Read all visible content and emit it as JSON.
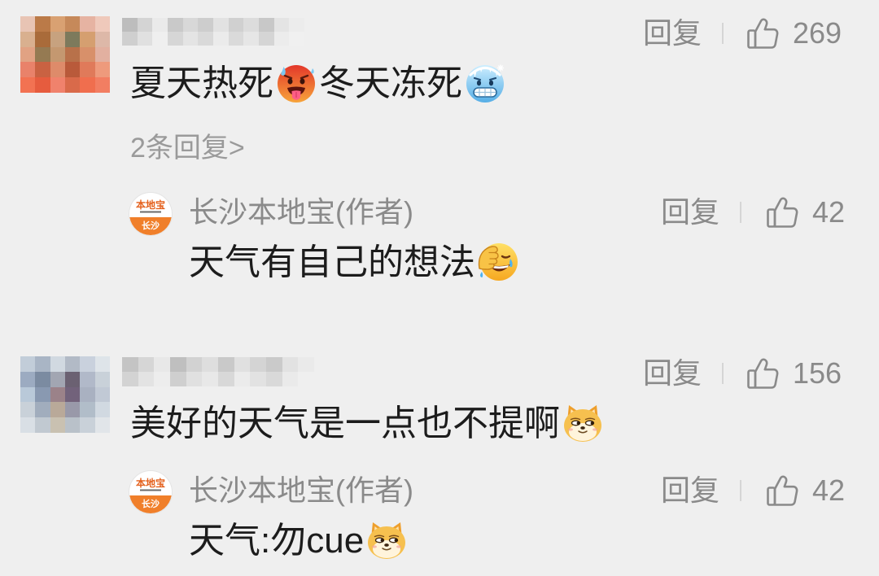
{
  "colors": {
    "bg": "#efefef",
    "text": "#1c1c1c",
    "secondary": "#8a8a8a",
    "tertiary": "#9a9a9a",
    "divider": "#d5d5d5",
    "brand": "#f07f2a",
    "brand_text": "#e4601c"
  },
  "comments": [
    {
      "avatar_mosaic": [
        [
          "#e8c4b4",
          "#bb7a48",
          "#d9a172",
          "#c6895a",
          "#e6b3a2",
          "#efc9bb"
        ],
        [
          "#d9b08f",
          "#a96b3a",
          "#c7a27f",
          "#7d7a5c",
          "#d59f70",
          "#ddb8a8"
        ],
        [
          "#e1a283",
          "#957a52",
          "#c49870",
          "#b8714a",
          "#d8906a",
          "#e2b0a0"
        ],
        [
          "#e9826a",
          "#c96242",
          "#de8b6a",
          "#b95a3a",
          "#e07a5a",
          "#ee9a7c"
        ],
        [
          "#f27252",
          "#e65c3e",
          "#f0826c",
          "#d96a4a",
          "#f06e4e",
          "#f27e62"
        ]
      ],
      "username_mosaic": [
        [
          "#bdbdbd",
          "#d4d4d4",
          "#eaeaea",
          "#c9c9c9",
          "#d8d8d8",
          "#cdcdcd",
          "#e2e2e2",
          "#d0d0d0",
          "#dcdcdc",
          "#c8c8c8",
          "#e4e4e4",
          "#ececec"
        ],
        [
          "#cfcfcf",
          "#e0e0e0",
          "#efefef",
          "#d6d6d6",
          "#e4e4e4",
          "#d9d9d9",
          "#ebebeb",
          "#dadada",
          "#e6e6e6",
          "#d5d5d5",
          "#ececec",
          "#f0f0f0"
        ]
      ],
      "reply_label": "回复",
      "likes": "269",
      "content": [
        {
          "text": "夏天热死"
        },
        {
          "emoji": "hot-face"
        },
        {
          "text": "冬天冻死"
        },
        {
          "emoji": "cold-face"
        }
      ],
      "replies_link": "2条回复>",
      "replies": [
        {
          "author": "长沙本地宝(作者)",
          "avatar_logo": {
            "top": "本地宝",
            "bottom": "长沙"
          },
          "reply_label": "回复",
          "likes": "42",
          "content": [
            {
              "text": "天气有自己的想法"
            },
            {
              "emoji": "facepalm"
            }
          ]
        }
      ]
    },
    {
      "avatar_mosaic": [
        [
          "#c2cdd9",
          "#a9b5c5",
          "#d1d9e1",
          "#b2bac6",
          "#c9d1dd",
          "#dee4e9"
        ],
        [
          "#9cabc1",
          "#7b8ba1",
          "#a2a6b2",
          "#6b6172",
          "#b1b9c9",
          "#c9d1d9"
        ],
        [
          "#b9c9d9",
          "#8999b1",
          "#9b8289",
          "#72627b",
          "#a9b1c1",
          "#c1c9d5"
        ],
        [
          "#c9d1d9",
          "#a1adbd",
          "#b9a999",
          "#9999a9",
          "#b1bdc9",
          "#d1d9e1"
        ],
        [
          "#d9dfe5",
          "#c1c9d1",
          "#c9c1b1",
          "#b9c1c9",
          "#c9d1d9",
          "#e1e5e9"
        ]
      ],
      "username_mosaic": [
        [
          "#c4c4c4",
          "#d6d6d6",
          "#e8e8e8",
          "#bfbfbf",
          "#d2d2d2",
          "#dedede",
          "#c9c9c9",
          "#e0e0e0",
          "#d4d4d4",
          "#cacaca",
          "#e2e2e2",
          "#eaeaea"
        ],
        [
          "#d3d3d3",
          "#e3e3e3",
          "#ededed",
          "#cfcfcf",
          "#e0e0e0",
          "#e8e8e8",
          "#d8d8d8",
          "#ebebeb",
          "#e2e2e2",
          "#d9d9d9",
          "#eaeaea",
          "#efefef"
        ]
      ],
      "reply_label": "回复",
      "likes": "156",
      "content": [
        {
          "text": "美好的天气是一点也不提啊"
        },
        {
          "emoji": "doge"
        }
      ],
      "replies": [
        {
          "author": "长沙本地宝(作者)",
          "avatar_logo": {
            "top": "本地宝",
            "bottom": "长沙"
          },
          "reply_label": "回复",
          "likes": "42",
          "content": [
            {
              "text": "天气:勿cue"
            },
            {
              "emoji": "doge"
            }
          ]
        }
      ]
    }
  ]
}
